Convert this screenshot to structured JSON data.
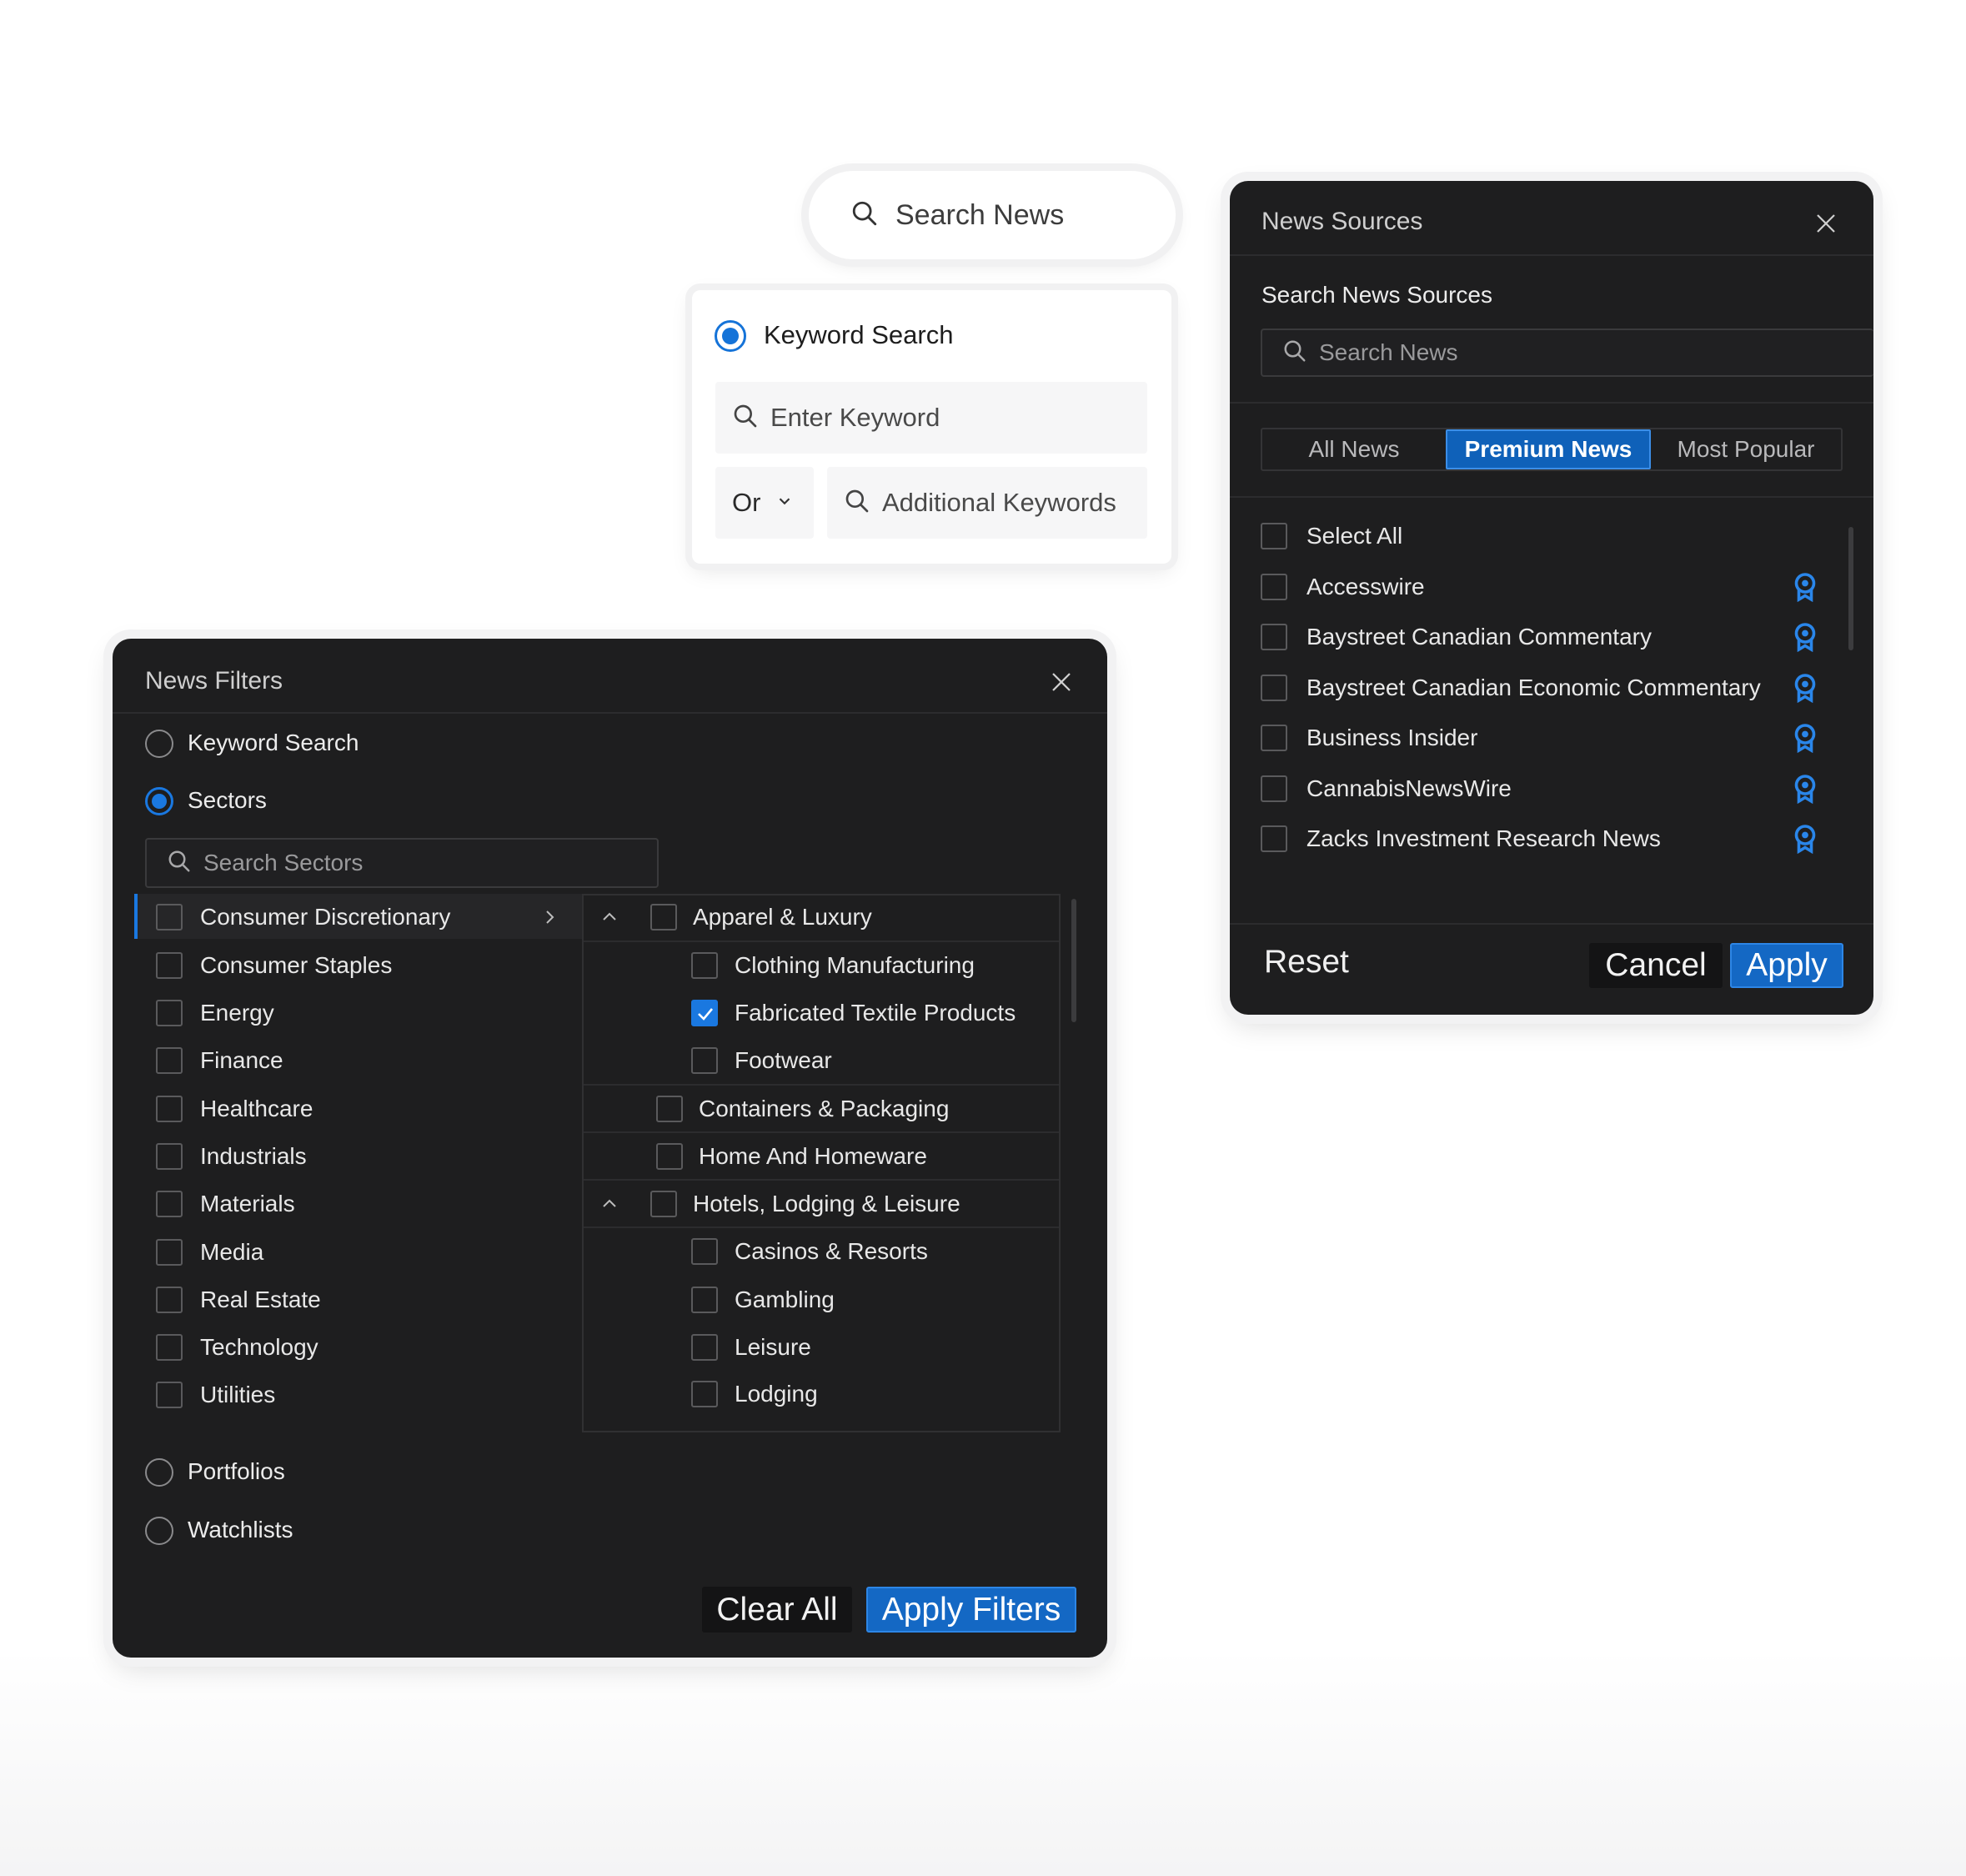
{
  "search_pill": {
    "placeholder": "Search News"
  },
  "keyword_card": {
    "radio_label": "Keyword Search",
    "keyword_placeholder": "Enter Keyword",
    "operator": "Or",
    "additional_placeholder": "Additional Keywords"
  },
  "news_sources": {
    "title": "News Sources",
    "search_label": "Search News Sources",
    "search_placeholder": "Search News",
    "tabs": [
      "All News",
      "Premium News",
      "Most Popular"
    ],
    "active_tab": "Premium News",
    "select_all": "Select All",
    "items": [
      "Accesswire",
      "Baystreet Canadian Commentary",
      "Baystreet Canadian Economic Commentary",
      "Business Insider",
      "CannabisNewsWire",
      "Zacks Investment Research News"
    ],
    "item_icon": "premium-ribbon-icon",
    "reset": "Reset",
    "cancel": "Cancel",
    "apply": "Apply"
  },
  "news_filters": {
    "title": "News Filters",
    "modes": [
      "Keyword Search",
      "Sectors",
      "Portfolios",
      "Watchlists"
    ],
    "selected_mode": "Sectors",
    "search_placeholder": "Search Sectors",
    "sectors": [
      "Consumer Discretionary",
      "Consumer Staples",
      "Energy",
      "Finance",
      "Healthcare",
      "Industrials",
      "Materials",
      "Media",
      "Real Estate",
      "Technology",
      "Utilities"
    ],
    "active_sector": "Consumer Discretionary",
    "subsectors": {
      "apparel": "Apparel & Luxury",
      "apparel_children": [
        "Clothing Manufacturing",
        "Fabricated Textile Products",
        "Footwear"
      ],
      "containers": "Containers & Packaging",
      "home": "Home And Homeware",
      "hotels": "Hotels, Lodging & Leisure",
      "hotels_children": [
        "Casinos & Resorts",
        "Gambling",
        "Leisure",
        "Lodging"
      ],
      "checked": "Fabricated Textile Products"
    },
    "clear_all": "Clear All",
    "apply_filters": "Apply Filters"
  },
  "colors": {
    "accent": "#1a78e0",
    "panel": "#1e1e1f",
    "button_blue": "#1468c4"
  }
}
